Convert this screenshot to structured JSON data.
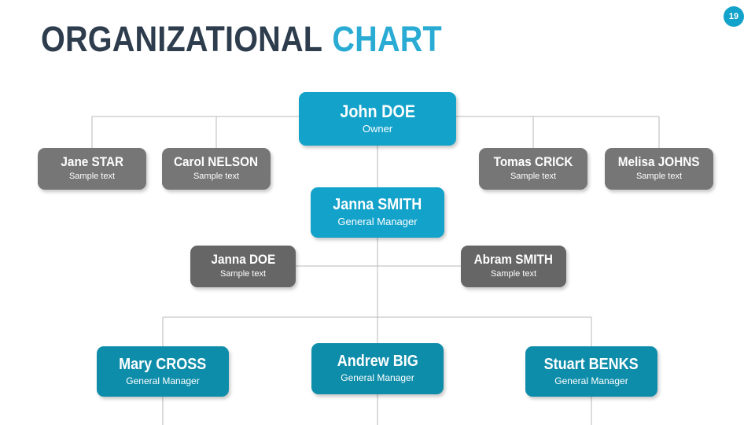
{
  "title": {
    "main": "ORGANIZATIONAL",
    "accent": "CHART"
  },
  "page_number": "19",
  "colors": {
    "accent_cyan": "#12a2ca",
    "accent_teal": "#0e8daa",
    "gray": "#767676",
    "gray_dark": "#666666",
    "title_dark": "#2e3d4d",
    "title_accent": "#29abd4",
    "connector": "#b8b8b8",
    "background": "#ffffff"
  },
  "chart_data": {
    "type": "diagram",
    "diagram_type": "organizational-chart",
    "title": "ORGANIZATIONAL CHART",
    "nodes": [
      {
        "id": "root",
        "name": "John DOE",
        "role": "Owner",
        "level": 0,
        "color": "#12a2ca"
      },
      {
        "id": "jane",
        "name": "Jane STAR",
        "role": "Sample text",
        "level": 1,
        "color": "#767676"
      },
      {
        "id": "carol",
        "name": "Carol NELSON",
        "role": "Sample text",
        "level": 1,
        "color": "#767676"
      },
      {
        "id": "tomas",
        "name": "Tomas CRICK",
        "role": "Sample text",
        "level": 1,
        "color": "#767676"
      },
      {
        "id": "melisa",
        "name": "Melisa JOHNS",
        "role": "Sample text",
        "level": 1,
        "color": "#767676"
      },
      {
        "id": "janna_s",
        "name": "Janna SMITH",
        "role": "General Manager",
        "level": 2,
        "color": "#12a2ca"
      },
      {
        "id": "janna_doe",
        "name": "Janna DOE",
        "role": "Sample text",
        "level": 3,
        "color": "#666666"
      },
      {
        "id": "abram",
        "name": "Abram SMITH",
        "role": "Sample text",
        "level": 3,
        "color": "#666666"
      },
      {
        "id": "mary",
        "name": "Mary CROSS",
        "role": "General Manager",
        "level": 4,
        "color": "#0e8daa"
      },
      {
        "id": "andrew",
        "name": "Andrew BIG",
        "role": "General Manager",
        "level": 4,
        "color": "#0e8daa"
      },
      {
        "id": "stuart",
        "name": "Stuart BENKS",
        "role": "General Manager",
        "level": 4,
        "color": "#0e8daa"
      }
    ],
    "edges": [
      {
        "from": "root",
        "to": "jane"
      },
      {
        "from": "root",
        "to": "carol"
      },
      {
        "from": "root",
        "to": "tomas"
      },
      {
        "from": "root",
        "to": "melisa"
      },
      {
        "from": "root",
        "to": "janna_s"
      },
      {
        "from": "janna_s",
        "to": "janna_doe"
      },
      {
        "from": "janna_s",
        "to": "abram"
      },
      {
        "from": "janna_s",
        "to": "mary"
      },
      {
        "from": "janna_s",
        "to": "andrew"
      },
      {
        "from": "janna_s",
        "to": "stuart"
      }
    ]
  },
  "nodes": {
    "root": {
      "name": "John DOE",
      "role": "Owner"
    },
    "jane": {
      "name": "Jane STAR",
      "role": "Sample text"
    },
    "carol": {
      "name": "Carol NELSON",
      "role": "Sample text"
    },
    "tomas": {
      "name": "Tomas CRICK",
      "role": "Sample text"
    },
    "melisa": {
      "name": "Melisa JOHNS",
      "role": "Sample text"
    },
    "janna_s": {
      "name": "Janna SMITH",
      "role": "General Manager"
    },
    "janna_doe": {
      "name": "Janna DOE",
      "role": "Sample text"
    },
    "abram": {
      "name": "Abram SMITH",
      "role": "Sample text"
    },
    "mary": {
      "name": "Mary CROSS",
      "role": "General Manager"
    },
    "andrew": {
      "name": "Andrew BIG",
      "role": "General Manager"
    },
    "stuart": {
      "name": "Stuart BENKS",
      "role": "General Manager"
    }
  }
}
